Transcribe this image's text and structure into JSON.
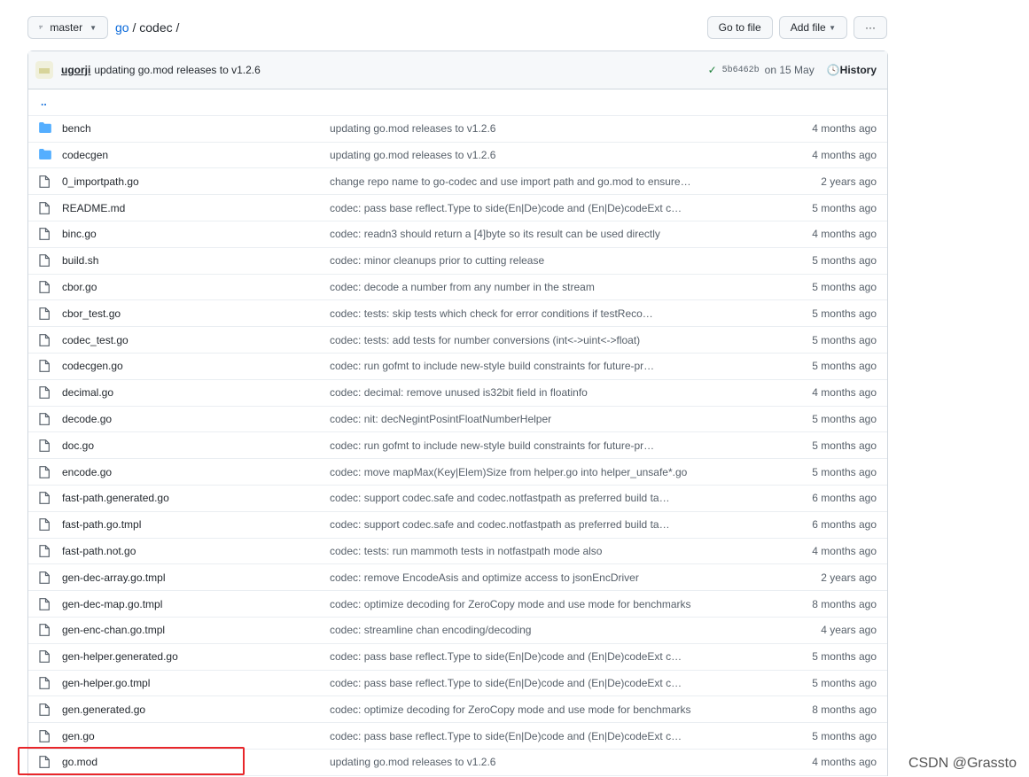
{
  "toolbar": {
    "branch": "master",
    "path_root": "go",
    "path_sep": "/",
    "path_current": "codec",
    "path_trail": "/",
    "goto_file": "Go to file",
    "add_file": "Add file",
    "more": "···"
  },
  "commit": {
    "user": "ugorji",
    "message": "updating go.mod releases to v1.2.6",
    "sha": "5b6462b",
    "date": "on 15 May",
    "history": "History"
  },
  "parent_dir": "..",
  "files": [
    {
      "type": "dir",
      "name": "bench",
      "msg": "updating go.mod releases to v1.2.6",
      "age": "4 months ago"
    },
    {
      "type": "dir",
      "name": "codecgen",
      "msg": "updating go.mod releases to v1.2.6",
      "age": "4 months ago"
    },
    {
      "type": "file",
      "name": "0_importpath.go",
      "msg": "change repo name to go-codec and use import path and go.mod to ensure…",
      "age": "2 years ago"
    },
    {
      "type": "file",
      "name": "README.md",
      "msg": "codec: pass base reflect.Type to side(En|De)code and (En|De)codeExt c…",
      "age": "5 months ago"
    },
    {
      "type": "file",
      "name": "binc.go",
      "msg": "codec: readn3 should return a [4]byte so its result can be used directly",
      "age": "4 months ago"
    },
    {
      "type": "file",
      "name": "build.sh",
      "msg": "codec: minor cleanups prior to cutting release",
      "age": "5 months ago"
    },
    {
      "type": "file",
      "name": "cbor.go",
      "msg": "codec: decode a number from any number in the stream",
      "age": "5 months ago"
    },
    {
      "type": "file",
      "name": "cbor_test.go",
      "msg": "codec: tests: skip tests which check for error conditions if testReco…",
      "age": "5 months ago"
    },
    {
      "type": "file",
      "name": "codec_test.go",
      "msg": "codec: tests: add tests for number conversions (int<->uint<->float)",
      "age": "5 months ago"
    },
    {
      "type": "file",
      "name": "codecgen.go",
      "msg": "codec: run gofmt to include new-style build constraints for future-pr…",
      "age": "5 months ago"
    },
    {
      "type": "file",
      "name": "decimal.go",
      "msg": "codec: decimal: remove unused is32bit field in floatinfo",
      "age": "4 months ago"
    },
    {
      "type": "file",
      "name": "decode.go",
      "msg": "codec: nit: decNegintPosintFloatNumberHelper",
      "age": "5 months ago"
    },
    {
      "type": "file",
      "name": "doc.go",
      "msg": "codec: run gofmt to include new-style build constraints for future-pr…",
      "age": "5 months ago"
    },
    {
      "type": "file",
      "name": "encode.go",
      "msg": "codec: move mapMax(Key|Elem)Size from helper.go into helper_unsafe*.go",
      "age": "5 months ago"
    },
    {
      "type": "file",
      "name": "fast-path.generated.go",
      "msg": "codec: support codec.safe and codec.notfastpath as preferred build ta…",
      "age": "6 months ago"
    },
    {
      "type": "file",
      "name": "fast-path.go.tmpl",
      "msg": "codec: support codec.safe and codec.notfastpath as preferred build ta…",
      "age": "6 months ago"
    },
    {
      "type": "file",
      "name": "fast-path.not.go",
      "msg": "codec: tests: run mammoth tests in notfastpath mode also",
      "age": "4 months ago"
    },
    {
      "type": "file",
      "name": "gen-dec-array.go.tmpl",
      "msg": "codec: remove EncodeAsis and optimize access to jsonEncDriver",
      "age": "2 years ago"
    },
    {
      "type": "file",
      "name": "gen-dec-map.go.tmpl",
      "msg": "codec: optimize decoding for ZeroCopy mode and use mode for benchmarks",
      "age": "8 months ago"
    },
    {
      "type": "file",
      "name": "gen-enc-chan.go.tmpl",
      "msg": "codec: streamline chan encoding/decoding",
      "age": "4 years ago"
    },
    {
      "type": "file",
      "name": "gen-helper.generated.go",
      "msg": "codec: pass base reflect.Type to side(En|De)code and (En|De)codeExt c…",
      "age": "5 months ago"
    },
    {
      "type": "file",
      "name": "gen-helper.go.tmpl",
      "msg": "codec: pass base reflect.Type to side(En|De)code and (En|De)codeExt c…",
      "age": "5 months ago"
    },
    {
      "type": "file",
      "name": "gen.generated.go",
      "msg": "codec: optimize decoding for ZeroCopy mode and use mode for benchmarks",
      "age": "8 months ago"
    },
    {
      "type": "file",
      "name": "gen.go",
      "msg": "codec: pass base reflect.Type to side(En|De)code and (En|De)codeExt c…",
      "age": "5 months ago"
    },
    {
      "type": "file",
      "name": "go.mod",
      "msg": "updating go.mod releases to v1.2.6",
      "age": "4 months ago"
    }
  ],
  "colors": {
    "folder": "#54aeff",
    "link": "#0969da",
    "highlight": "#e8262a"
  },
  "watermark": "CSDN @Grassto"
}
